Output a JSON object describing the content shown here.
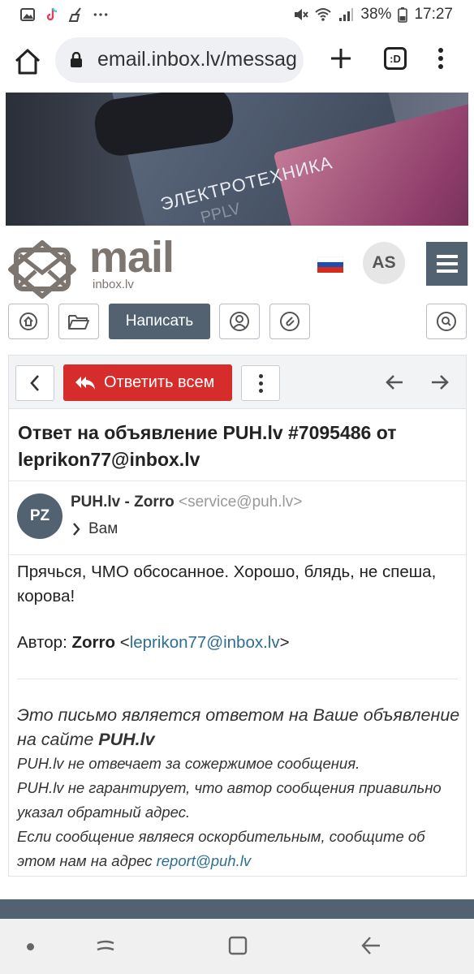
{
  "status_bar": {
    "battery": "38%",
    "time": "17:27"
  },
  "browser": {
    "url": "email.inbox.lv/messag",
    "tabs_label": ":D"
  },
  "banner": {
    "caption": "ЭЛЕКТРОТЕХНИКА",
    "badge": "PPLV"
  },
  "site": {
    "logo_word": "mail",
    "logo_sub": "inbox.lv",
    "user_initials": "AS"
  },
  "toolbar": {
    "compose_label": "Написать"
  },
  "message": {
    "reply_all_label": "Ответить всем",
    "subject": "Ответ на объявление PUH.lv #7095486 от leprikon77@inbox.lv",
    "sender_initials": "PZ",
    "sender_name": "PUH.lv - Zorro",
    "sender_email": "<service@puh.lv>",
    "recipient": "Вам",
    "body": "Прячься, ЧМО обсосанное. Хорошо, блядь, не спеша, корова!",
    "author_label": "Автор:",
    "author_name": "Zorro",
    "author_email_open": "<",
    "author_email": "leprikon77@inbox.lv",
    "author_email_close": ">",
    "notice_lead": "Это письмо является ответом на Ваше объявление на сайте",
    "notice_site": "PUH.lv",
    "notice_line1": "PUH.lv не отвечает за сожержимое сообщения.",
    "notice_line2": "PUH.lv не гарантирует, что автор сообщения приавильно указал обратный адрес.",
    "notice_line3": "Если сообщение являеся оскорбительным, сообщите об этом нам на адрес",
    "report_email": "report@puh.lv"
  },
  "colors": {
    "accent": "#536270",
    "reply_red": "#d62c2c",
    "link": "#2e6e93"
  },
  "icons": [
    "image-icon",
    "tiktok-icon",
    "broom-icon",
    "more-icon",
    "mute-icon",
    "wifi-icon",
    "signal-icon",
    "battery-icon",
    "home-icon",
    "lock-icon",
    "plus-icon",
    "kebab-icon",
    "flag-ru-icon",
    "hamburger-icon",
    "inbox-icon",
    "folder-icon",
    "contacts-icon",
    "attachment-icon",
    "search-icon",
    "chevron-left-icon",
    "reply-all-icon",
    "arrow-left-icon",
    "arrow-right-icon",
    "chevron-right-icon"
  ]
}
